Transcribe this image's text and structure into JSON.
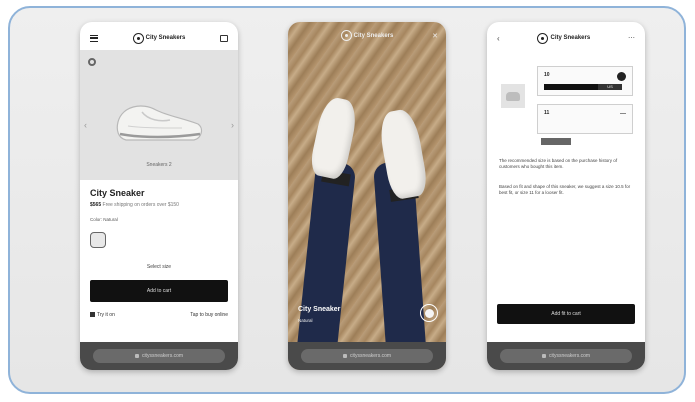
{
  "colors": {
    "frame_border": "#8fb3d9",
    "primary_button": "#111111",
    "bottom_bar": "#4a4a4a"
  },
  "screen1": {
    "logo_text": "City Sneakers",
    "image_caption": "Sneakers 2",
    "product_name": "City Sneaker",
    "price": "$565",
    "price_note": "Free shipping on orders over $150",
    "color_label": "Color: Natural",
    "size_link": "Select size",
    "add_button": "Add to cart",
    "actions": [
      "Try it on",
      "Tap to buy online"
    ],
    "url": "cityssneakers.com"
  },
  "screen2": {
    "logo_text": "City Sneakers",
    "close": "✕",
    "product_name": "City Sneaker",
    "product_sub": "Natural",
    "url": "cityssneakers.com"
  },
  "screen3": {
    "logo_text": "City Sneakers",
    "back": "‹",
    "more": "⋯",
    "field1": "10",
    "field1_tag": "US",
    "field2": "11",
    "paragraph1": "The recommended size is based on the purchase history of customers who bought this item.",
    "paragraph2": "Based on fit and shape of this sneaker, we suggest a size 10.5 for best fit, or size 11 for a looser fit.",
    "fit_button": "Add fit to cart",
    "url": "cityssneakers.com"
  }
}
